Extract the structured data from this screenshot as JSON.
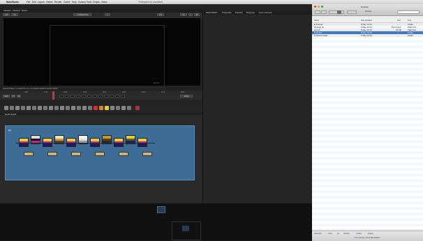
{
  "menubar": {
    "apple_icon": "apple-icon",
    "items": [
      "NukeStudio",
      "File",
      "Edit",
      "Layout",
      "Viewer",
      "Render",
      "Cache",
      "Help",
      "Custom Tools",
      "Scripts",
      "Views"
    ],
    "window_title": "/Philrig/test.nk (modified)"
  },
  "nuke": {
    "viewer_tabs": [
      "Viewer1",
      "Viewer2",
      "Roto1"
    ],
    "props_tabs": [
      "Script Editor",
      "Properties",
      "Preview",
      "Progress",
      "Error Console"
    ],
    "viewer_toolbar": {
      "channel_select": "rgba",
      "view_select": "rgb",
      "input_a": "1 Grid/Backdrop",
      "input_b": "1",
      "zoom": "Full",
      "fstop": "f/8",
      "gamma": "1",
      "cam": "2D"
    },
    "viewer_status": "1024x576  BBox: 0 0 1024 576  x=0 y=0  0.00000 0.00000 0.00000 0.00000",
    "viewer_info": "fps 24.0",
    "timeline": {
      "current_frame": "1001",
      "frame_labels": [
        "1001",
        "1010",
        "1020",
        "1030",
        "1040",
        "1050",
        "1060",
        "1070",
        "1080"
      ],
      "playback_mode": "TC",
      "fps": "24",
      "range_label": "global"
    },
    "node_graph_tabs": [
      "Node Graph"
    ],
    "backdrop_label": "BG",
    "dope_label": "Dope Sheet"
  },
  "finder": {
    "title": "Desktop",
    "toolbar_label": "Desktop",
    "columns": [
      "Name",
      "Date Modified",
      "Size",
      "Kind"
    ],
    "rows": [
      {
        "name": "▸ testnuke",
        "date": "Today, 10:12",
        "size": "--",
        "kind": "Folder",
        "sel": false
      },
      {
        "name": "   photoup.nk",
        "date": "Today, 10:14",
        "size": "Zero bytes",
        "kind": "Plain Text",
        "sel": false
      },
      {
        "name": "   test.nk",
        "date": "Today, 10:14",
        "size": "24 KB",
        "kind": "Plain Text",
        "sel": false
      },
      {
        "name": "▾ renders",
        "date": "Today, 10:15",
        "size": "--",
        "kind": "Folder",
        "sel": true
      },
      {
        "name": "▸ Artwork folder",
        "date": "Today, 10:15",
        "size": "--",
        "kind": "Folder",
        "sel": false
      }
    ],
    "status_items": [
      "Macintosh",
      "Users",
      "ph",
      "Desktop",
      "renders",
      "Images"
    ],
    "status_text": "1 of 9 selected, 42.94 GB available"
  },
  "colors": {
    "backdrop": "#3d6d97",
    "selection": "#3875d7",
    "accent_red": "#cc3333"
  }
}
